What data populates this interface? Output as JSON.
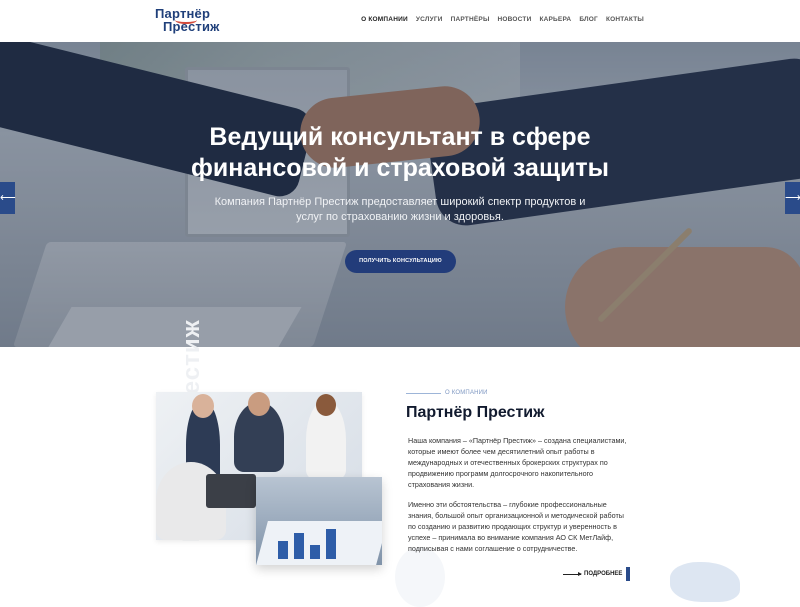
{
  "header": {
    "logo_line1": "Партнёр",
    "logo_line2": "Престиж",
    "nav": [
      {
        "label": "О КОМПАНИИ",
        "active": true
      },
      {
        "label": "УСЛУГИ",
        "active": false
      },
      {
        "label": "ПАРТНЁРЫ",
        "active": false
      },
      {
        "label": "НОВОСТИ",
        "active": false
      },
      {
        "label": "КАРЬЕРА",
        "active": false
      },
      {
        "label": "БЛОГ",
        "active": false
      },
      {
        "label": "КОНТАКТЫ",
        "active": false
      }
    ]
  },
  "hero": {
    "title_line1": "Ведущий консультант в сфере",
    "title_line2": "финансовой и страховой защиты",
    "subtitle_line1": "Компания Партнёр Престиж предоставляет широкий спектр продуктов и",
    "subtitle_line2": "услуг по страхованию жизни и здоровья.",
    "cta_label": "ПОЛУЧИТЬ КОНСУЛЬТАЦИЮ",
    "prev_icon": "chevron-left-icon",
    "next_icon": "chevron-right-icon",
    "prev_glyph": "⟵",
    "next_glyph": "⟶"
  },
  "about": {
    "vertical_word": "Партнёр Престиж",
    "section_tag": "О КОМПАНИИ",
    "title": "Партнёр Престиж",
    "paragraph1": "Наша компания – «Партнёр Престиж» – создана специалистами, которые имеют более чем десятилетний опыт работы в международных и отечественных брокерских структурах по продвижению программ долгосрочного накопительного страхования жизни.",
    "paragraph2": "Именно эти обстоятельства – глубокие профессиональные знания, большой опыт организационной и методической работы по созданию и развитию продающих структур и уверенность в успехе – принимала во внимание компания АО СК МетЛайф, подписывая с нами соглашение о сотрудничестве.",
    "more_label": "ПОДРОБНЕЕ"
  },
  "colors": {
    "brand": "#1f3f7a",
    "button": "#223c7a",
    "arrow_bg": "#2a4b8a",
    "accent_logo": "#d24b3c"
  }
}
